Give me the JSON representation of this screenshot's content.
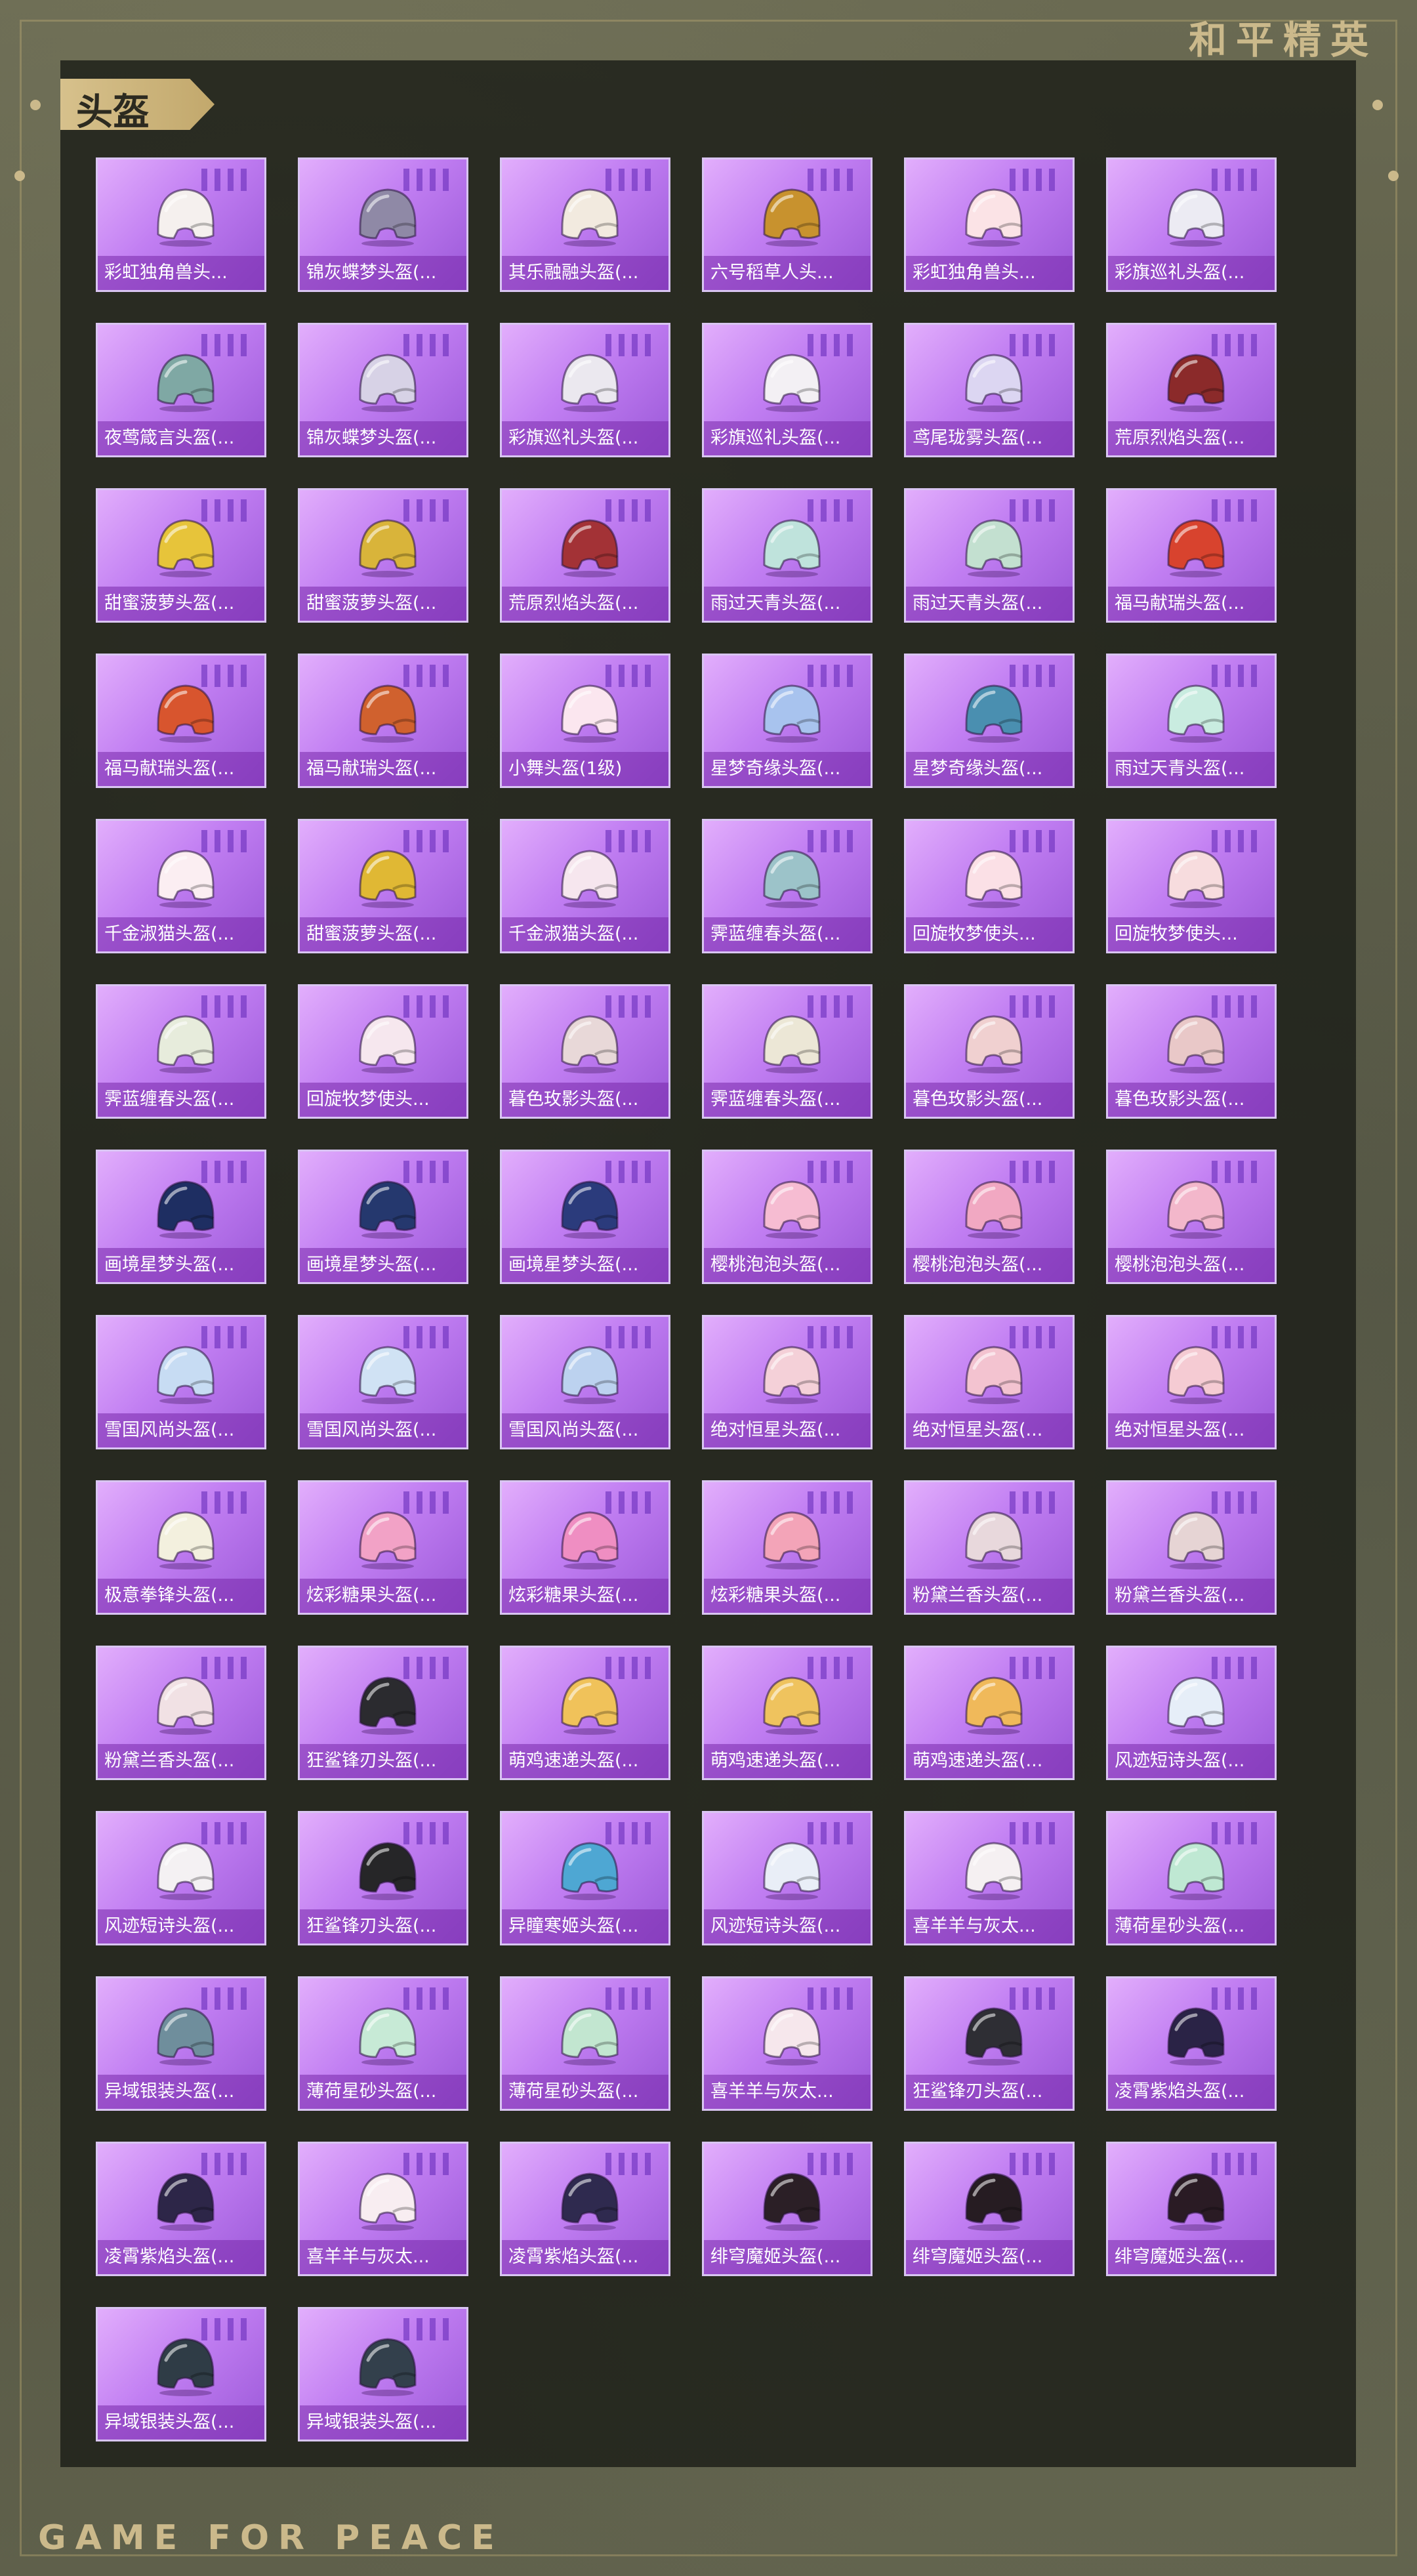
{
  "brand": {
    "top": "和平精英",
    "bottom": "GAME FOR PEACE"
  },
  "section": {
    "title": "头盔"
  },
  "colors": {
    "card_accent": "#c17ef2",
    "gold": "#cbb98b"
  },
  "items": [
    {
      "name": "彩虹独角兽头...",
      "helmet_color": "#f5f0ee"
    },
    {
      "name": "锦灰蝶梦头盔(...",
      "helmet_color": "#8f89a6"
    },
    {
      "name": "其乐融融头盔(...",
      "helmet_color": "#f2eadf"
    },
    {
      "name": "六号稻草人头...",
      "helmet_color": "#c8922e"
    },
    {
      "name": "彩虹独角兽头...",
      "helmet_color": "#fbe3e6"
    },
    {
      "name": "彩旗巡礼头盔(...",
      "helmet_color": "#ecebf3"
    },
    {
      "name": "夜莺箴言头盔(...",
      "helmet_color": "#7fa8a4"
    },
    {
      "name": "锦灰蝶梦头盔(...",
      "helmet_color": "#d7d2e6"
    },
    {
      "name": "彩旗巡礼头盔(...",
      "helmet_color": "#ebe8ef"
    },
    {
      "name": "彩旗巡礼头盔(...",
      "helmet_color": "#f3f0f4"
    },
    {
      "name": "鸢尾珑雾头盔(...",
      "helmet_color": "#dcd6f2"
    },
    {
      "name": "荒原烈焰头盔(...",
      "helmet_color": "#8b2a2a"
    },
    {
      "name": "甜蜜菠萝头盔(...",
      "helmet_color": "#e7c43a"
    },
    {
      "name": "甜蜜菠萝头盔(...",
      "helmet_color": "#d9b43a"
    },
    {
      "name": "荒原烈焰头盔(...",
      "helmet_color": "#a33236"
    },
    {
      "name": "雨过天青头盔(...",
      "helmet_color": "#bfe3dc"
    },
    {
      "name": "雨过天青头盔(...",
      "helmet_color": "#c3e0d0"
    },
    {
      "name": "福马献瑞头盔(...",
      "helmet_color": "#d8432e"
    },
    {
      "name": "福马献瑞头盔(...",
      "helmet_color": "#d8552e"
    },
    {
      "name": "福马献瑞头盔(...",
      "helmet_color": "#d0612e"
    },
    {
      "name": "小舞头盔(1级)",
      "helmet_color": "#fbe6ef"
    },
    {
      "name": "星梦奇缘头盔(...",
      "helmet_color": "#a8c3ee"
    },
    {
      "name": "星梦奇缘头盔(...",
      "helmet_color": "#4a8fb0"
    },
    {
      "name": "雨过天青头盔(...",
      "helmet_color": "#c9ece0"
    },
    {
      "name": "千金淑猫头盔(...",
      "helmet_color": "#fbeef2"
    },
    {
      "name": "甜蜜菠萝头盔(...",
      "helmet_color": "#e0b834"
    },
    {
      "name": "千金淑猫头盔(...",
      "helmet_color": "#f6e6ee"
    },
    {
      "name": "霁蓝缠春头盔(...",
      "helmet_color": "#9cc3c9"
    },
    {
      "name": "回旋牧梦使头...",
      "helmet_color": "#fbe0e6"
    },
    {
      "name": "回旋牧梦使头...",
      "helmet_color": "#f7dcde"
    },
    {
      "name": "霁蓝缠春头盔(...",
      "helmet_color": "#e7ecdc"
    },
    {
      "name": "回旋牧梦使头...",
      "helmet_color": "#f6e7ee"
    },
    {
      "name": "暮色玫影头盔(...",
      "helmet_color": "#e8d8d8"
    },
    {
      "name": "霁蓝缠春头盔(...",
      "helmet_color": "#ece7d6"
    },
    {
      "name": "暮色玫影头盔(...",
      "helmet_color": "#f0d0d0"
    },
    {
      "name": "暮色玫影头盔(...",
      "helmet_color": "#e9c8c8"
    },
    {
      "name": "画境星梦头盔(...",
      "helmet_color": "#1e2e62"
    },
    {
      "name": "画境星梦头盔(...",
      "helmet_color": "#25386e"
    },
    {
      "name": "画境星梦头盔(...",
      "helmet_color": "#2b3b7c"
    },
    {
      "name": "樱桃泡泡头盔(...",
      "helmet_color": "#f6bcd2"
    },
    {
      "name": "樱桃泡泡头盔(...",
      "helmet_color": "#f1a8c2"
    },
    {
      "name": "樱桃泡泡头盔(...",
      "helmet_color": "#f3b7cb"
    },
    {
      "name": "雪国风尚头盔(...",
      "helmet_color": "#c7dcf3"
    },
    {
      "name": "雪国风尚头盔(...",
      "helmet_color": "#d0e2f4"
    },
    {
      "name": "雪国风尚头盔(...",
      "helmet_color": "#bcd2ef"
    },
    {
      "name": "绝对恒星头盔(...",
      "helmet_color": "#f4d0d8"
    },
    {
      "name": "绝对恒星头盔(...",
      "helmet_color": "#f3c3d0"
    },
    {
      "name": "绝对恒星头盔(...",
      "helmet_color": "#f5cbd3"
    },
    {
      "name": "极意拳锋头盔(...",
      "helmet_color": "#f3f0de"
    },
    {
      "name": "炫彩糖果头盔(...",
      "helmet_color": "#f2a2c6"
    },
    {
      "name": "炫彩糖果头盔(...",
      "helmet_color": "#ef8ec2"
    },
    {
      "name": "炫彩糖果头盔(...",
      "helmet_color": "#f3a4b8"
    },
    {
      "name": "粉黛兰香头盔(...",
      "helmet_color": "#e8d8dc"
    },
    {
      "name": "粉黛兰香头盔(...",
      "helmet_color": "#e6d4d4"
    },
    {
      "name": "粉黛兰香头盔(...",
      "helmet_color": "#f1e1e4"
    },
    {
      "name": "狂鲨锋刃头盔(...",
      "helmet_color": "#2b2b2f"
    },
    {
      "name": "萌鸡速递头盔(...",
      "helmet_color": "#f0c25a"
    },
    {
      "name": "萌鸡速递头盔(...",
      "helmet_color": "#efc35e"
    },
    {
      "name": "萌鸡速递头盔(...",
      "helmet_color": "#f0b95a"
    },
    {
      "name": "风迹短诗头盔(...",
      "helmet_color": "#e6eef8"
    },
    {
      "name": "风迹短诗头盔(...",
      "helmet_color": "#f4f1f3"
    },
    {
      "name": "狂鲨锋刃头盔(...",
      "helmet_color": "#262628"
    },
    {
      "name": "异瞳寒姬头盔(...",
      "helmet_color": "#4ea7d3"
    },
    {
      "name": "风迹短诗头盔(...",
      "helmet_color": "#e9eef7"
    },
    {
      "name": "喜羊羊与灰太...",
      "helmet_color": "#f5f0f2"
    },
    {
      "name": "薄荷星砂头盔(...",
      "helmet_color": "#bfe8d3"
    },
    {
      "name": "异域银装头盔(...",
      "helmet_color": "#6f8e9c"
    },
    {
      "name": "薄荷星砂头盔(...",
      "helmet_color": "#c7ead6"
    },
    {
      "name": "薄荷星砂头盔(...",
      "helmet_color": "#c2e6d0"
    },
    {
      "name": "喜羊羊与灰太...",
      "helmet_color": "#f6e7ec"
    },
    {
      "name": "狂鲨锋刃头盔(...",
      "helmet_color": "#2e2e34"
    },
    {
      "name": "凌霄紫焰头盔(...",
      "helmet_color": "#2a2346"
    },
    {
      "name": "凌霄紫焰头盔(...",
      "helmet_color": "#2d2648"
    },
    {
      "name": "喜羊羊与灰太...",
      "helmet_color": "#f8edf1"
    },
    {
      "name": "凌霄紫焰头盔(...",
      "helmet_color": "#2f2a4f"
    },
    {
      "name": "绯穹魔姬头盔(...",
      "helmet_color": "#2b1f26"
    },
    {
      "name": "绯穹魔姬头盔(...",
      "helmet_color": "#261c22"
    },
    {
      "name": "绯穹魔姬头盔(...",
      "helmet_color": "#2a1b24"
    },
    {
      "name": "异域银装头盔(...",
      "helmet_color": "#2f3c46"
    },
    {
      "name": "异域银装头盔(...",
      "helmet_color": "#33404c"
    }
  ]
}
